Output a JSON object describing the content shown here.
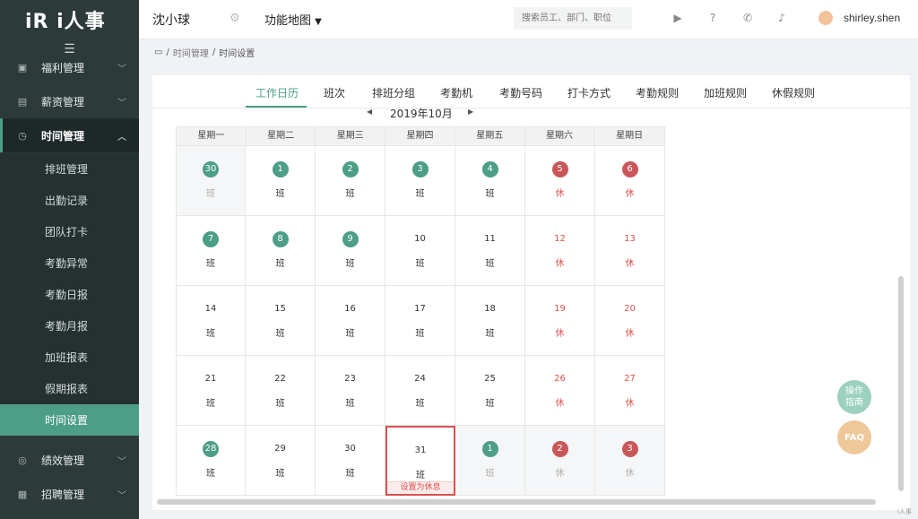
{
  "app": {
    "logo": "iR i人事"
  },
  "sidebar": {
    "toggle_icon": "hamburger-icon",
    "items": [
      {
        "label": "福利管理",
        "icon": "gift-icon"
      },
      {
        "label": "薪资管理",
        "icon": "wallet-icon"
      },
      {
        "label": "时间管理",
        "icon": "clock-icon"
      },
      {
        "label": "绩效管理",
        "icon": "target-icon"
      },
      {
        "label": "招聘管理",
        "icon": "briefcase-icon"
      }
    ],
    "sub_items": [
      "排班管理",
      "出勤记录",
      "团队打卡",
      "考勤异常",
      "考勤日报",
      "考勤月报",
      "加班报表",
      "假期报表",
      "时间设置"
    ]
  },
  "header": {
    "company": "沈小球",
    "function_map": "功能地图",
    "search_placeholder": "搜索员工、部门、职位",
    "username": "shirley.shen"
  },
  "breadcrumb": {
    "level1": "时间管理",
    "level2": "时间设置"
  },
  "tabs": [
    "工作日历",
    "班次",
    "排班分组",
    "考勤机",
    "考勤号码",
    "打卡方式",
    "考勤规则",
    "加班规则",
    "休假规则"
  ],
  "active_tab": "工作日历",
  "calendar": {
    "month_label": "2019年10月",
    "weekdays": [
      "星期一",
      "星期二",
      "星期三",
      "星期四",
      "星期五",
      "星期六",
      "星期日"
    ],
    "rows": [
      [
        {
          "d": "30",
          "s": "班"
        },
        {
          "d": "1",
          "s": "班"
        },
        {
          "d": "2",
          "s": "班"
        },
        {
          "d": "3",
          "s": "班"
        },
        {
          "d": "4",
          "s": "班"
        },
        {
          "d": "5",
          "s": "休"
        },
        {
          "d": "6",
          "s": "休"
        }
      ],
      [
        {
          "d": "7",
          "s": "班"
        },
        {
          "d": "8",
          "s": "班"
        },
        {
          "d": "9",
          "s": "班"
        },
        {
          "d": "10",
          "s": "班"
        },
        {
          "d": "11",
          "s": "班"
        },
        {
          "d": "12",
          "s": "休"
        },
        {
          "d": "13",
          "s": "休"
        }
      ],
      [
        {
          "d": "14",
          "s": "班"
        },
        {
          "d": "15",
          "s": "班"
        },
        {
          "d": "16",
          "s": "班"
        },
        {
          "d": "17",
          "s": "班"
        },
        {
          "d": "18",
          "s": "班"
        },
        {
          "d": "19",
          "s": "休"
        },
        {
          "d": "20",
          "s": "休"
        }
      ],
      [
        {
          "d": "21",
          "s": "班"
        },
        {
          "d": "22",
          "s": "班"
        },
        {
          "d": "23",
          "s": "班"
        },
        {
          "d": "24",
          "s": "班"
        },
        {
          "d": "25",
          "s": "班"
        },
        {
          "d": "26",
          "s": "休"
        },
        {
          "d": "27",
          "s": "休"
        }
      ],
      [
        {
          "d": "28",
          "s": "班"
        },
        {
          "d": "29",
          "s": "班"
        },
        {
          "d": "30",
          "s": "班"
        },
        {
          "d": "31",
          "s": "班"
        },
        {
          "d": "1",
          "s": "班"
        },
        {
          "d": "2",
          "s": "休"
        },
        {
          "d": "3",
          "s": "休"
        }
      ]
    ],
    "set_rest_label": "设置为休息"
  },
  "floating": {
    "guide": "操作\n指南",
    "faq": "FAQ"
  },
  "watermark": "i人事",
  "colors": {
    "accent": "#4c9e86",
    "rest": "#d9534f",
    "sidebar": "#2d3a3a"
  }
}
